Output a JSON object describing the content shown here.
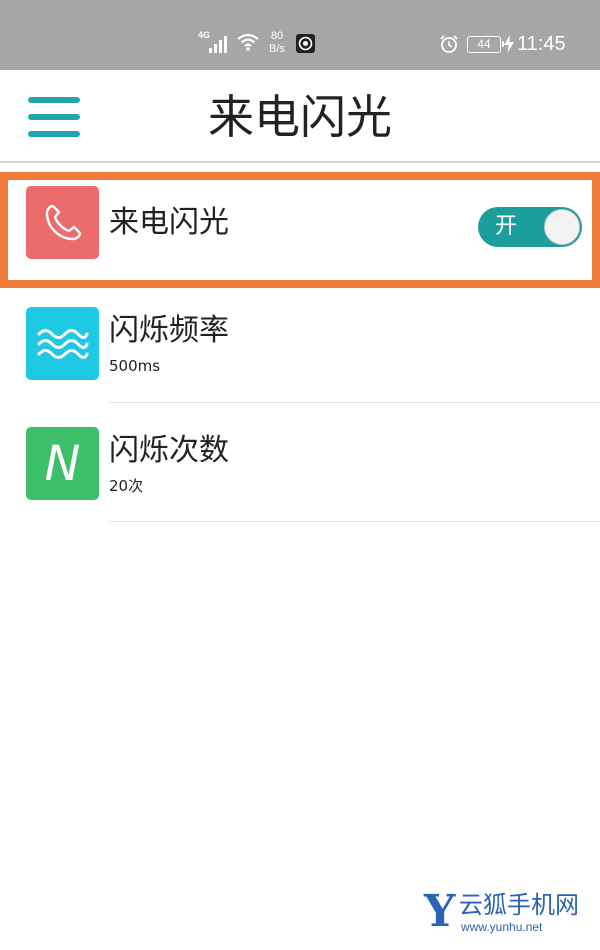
{
  "status_bar": {
    "network_type": "4G",
    "net_speed_value": "80",
    "net_speed_unit": "B/s",
    "battery_level": "44",
    "time": "11:45",
    "icons": [
      "signal-icon",
      "wifi-icon",
      "app-notification-icon",
      "alarm-icon",
      "battery-icon",
      "charging-icon"
    ]
  },
  "app_bar": {
    "title": "来电闪光",
    "menu_icon": "hamburger-menu-icon",
    "accent_color": "#22a6ab"
  },
  "settings": [
    {
      "label": "来电闪光",
      "icon": "phone-icon",
      "icon_color": "#ec6b6b",
      "toggle": {
        "label": "开",
        "state": "on",
        "color": "#1b9e9c"
      },
      "highlighted": true,
      "highlight_color": "#f07a3a"
    },
    {
      "label": "闪烁频率",
      "value": "500ms",
      "icon": "wave-icon",
      "icon_color": "#1fc8e3"
    },
    {
      "label": "闪烁次数",
      "value": "20次",
      "icon": "letter-n-icon",
      "icon_glyph": "N",
      "icon_color": "#3ec06a"
    }
  ],
  "watermark": {
    "logo_letter": "Y",
    "brand": "云狐手机网",
    "url": "www.yunhu.net",
    "color": "#2c63b4"
  }
}
